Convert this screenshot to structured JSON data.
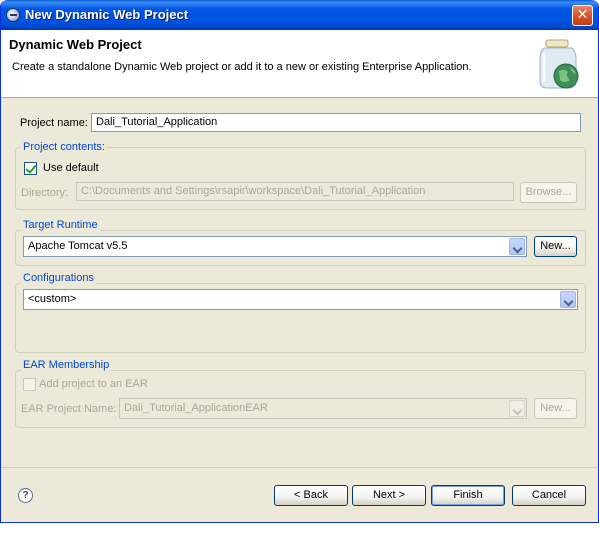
{
  "window": {
    "title": "New Dynamic Web Project",
    "close_glyph": "✕"
  },
  "header": {
    "title": "Dynamic Web Project",
    "description": "Create a standalone Dynamic Web project or add it to a new or existing Enterprise Application."
  },
  "project_name": {
    "label": "Project name:",
    "value": "Dali_Tutorial_Application"
  },
  "project_contents": {
    "group_label": "Project contents:",
    "use_default_label": "Use default",
    "use_default_checked": true,
    "directory_label": "Directory:",
    "directory_value": "C:\\Documents and Settings\\rsapir\\workspace\\Dali_Tutorial_Application",
    "browse_label": "Browse..."
  },
  "target_runtime": {
    "group_label": "Target Runtime",
    "selected": "Apache Tomcat v5.5",
    "new_label": "New..."
  },
  "configurations": {
    "group_label": "Configurations",
    "selected": "<custom>"
  },
  "ear_membership": {
    "group_label": "EAR Membership",
    "add_label": "Add project to an EAR",
    "add_checked": false,
    "ear_project_name_label": "EAR Project Name:",
    "ear_project_value": "Dali_Tutorial_ApplicationEAR",
    "new_label": "New..."
  },
  "footer": {
    "help_glyph": "?",
    "back_label": "< Back",
    "next_label": "Next >",
    "finish_label": "Finish",
    "cancel_label": "Cancel"
  }
}
